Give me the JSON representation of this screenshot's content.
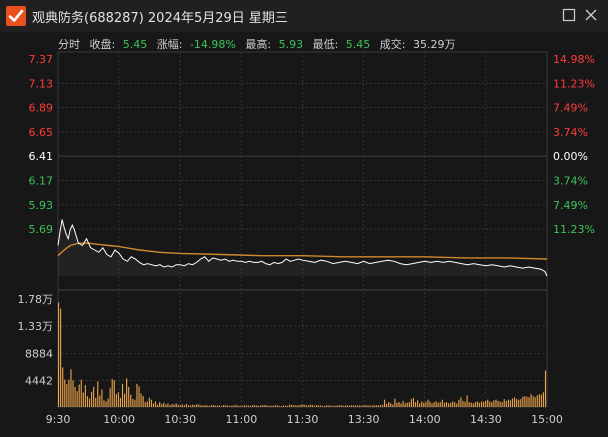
{
  "window": {
    "title": "观典防务(688287) 2024年5月29日 星期三"
  },
  "info_bar": {
    "mode_label": "分时",
    "close_label": "收盘:",
    "close_value": "5.45",
    "change_label": "涨幅:",
    "change_value": "-14.98%",
    "high_label": "最高:",
    "high_value": "5.93",
    "low_label": "最低:",
    "low_value": "5.45",
    "volume_label": "成交:",
    "volume_value": "35.29万"
  },
  "colors": {
    "up": "#ff3b3b",
    "down": "#3cc35a",
    "flat": "#ffffff",
    "price_line": "#ffffff",
    "avg_line": "#d08a2a",
    "volume_bar": "#e8a24a",
    "grid": "#3a3a3a",
    "background": "#171717"
  },
  "chart_data": {
    "type": "line",
    "price_axis_left": [
      "7.37",
      "7.13",
      "6.89",
      "6.65",
      "6.41",
      "6.17",
      "5.93",
      "5.69"
    ],
    "price_axis_right": [
      "14.98%",
      "11.23%",
      "7.49%",
      "3.74%",
      "0.00%",
      "3.74%",
      "7.49%",
      "11.23%"
    ],
    "price_axis_colors": [
      "up",
      "up",
      "up",
      "up",
      "flat",
      "down",
      "down",
      "down"
    ],
    "price_ylim": [
      5.45,
      7.37
    ],
    "volume_axis": [
      "1.78万",
      "1.33万",
      "8884",
      "4442"
    ],
    "volume_ylim": [
      0,
      17768
    ],
    "time_axis": [
      "9:30",
      "10:00",
      "10:30",
      "11:00",
      "11:30",
      "13:30",
      "14:00",
      "14:30",
      "15:00"
    ],
    "series": [
      {
        "name": "price",
        "points": [
          [
            0,
            5.72
          ],
          [
            1,
            5.84
          ],
          [
            2,
            5.95
          ],
          [
            3,
            5.88
          ],
          [
            4,
            5.82
          ],
          [
            5,
            5.78
          ],
          [
            6,
            5.86
          ],
          [
            7,
            5.9
          ],
          [
            8,
            5.86
          ],
          [
            9,
            5.8
          ],
          [
            10,
            5.74
          ],
          [
            12,
            5.72
          ],
          [
            14,
            5.78
          ],
          [
            16,
            5.7
          ],
          [
            18,
            5.68
          ],
          [
            20,
            5.66
          ],
          [
            22,
            5.7
          ],
          [
            24,
            5.64
          ],
          [
            26,
            5.62
          ],
          [
            28,
            5.68
          ],
          [
            30,
            5.65
          ],
          [
            32,
            5.6
          ],
          [
            34,
            5.58
          ],
          [
            36,
            5.62
          ],
          [
            38,
            5.6
          ],
          [
            40,
            5.57
          ],
          [
            42,
            5.55
          ],
          [
            44,
            5.56
          ],
          [
            46,
            5.55
          ],
          [
            48,
            5.54
          ],
          [
            50,
            5.55
          ],
          [
            52,
            5.53
          ],
          [
            54,
            5.54
          ],
          [
            56,
            5.53
          ],
          [
            58,
            5.55
          ],
          [
            60,
            5.55
          ],
          [
            62,
            5.54
          ],
          [
            64,
            5.56
          ],
          [
            66,
            5.55
          ],
          [
            68,
            5.57
          ],
          [
            70,
            5.6
          ],
          [
            72,
            5.62
          ],
          [
            74,
            5.58
          ],
          [
            76,
            5.61
          ],
          [
            78,
            5.6
          ],
          [
            80,
            5.59
          ],
          [
            82,
            5.6
          ],
          [
            84,
            5.58
          ],
          [
            86,
            5.59
          ],
          [
            88,
            5.58
          ],
          [
            90,
            5.58
          ],
          [
            92,
            5.57
          ],
          [
            94,
            5.58
          ],
          [
            96,
            5.57
          ],
          [
            98,
            5.57
          ],
          [
            100,
            5.58
          ],
          [
            102,
            5.56
          ],
          [
            104,
            5.55
          ],
          [
            106,
            5.57
          ],
          [
            108,
            5.56
          ],
          [
            110,
            5.57
          ],
          [
            112,
            5.6
          ],
          [
            114,
            5.58
          ],
          [
            116,
            5.59
          ],
          [
            118,
            5.6
          ],
          [
            120,
            5.59
          ],
          [
            123,
            5.58
          ],
          [
            126,
            5.57
          ],
          [
            129,
            5.59
          ],
          [
            132,
            5.58
          ],
          [
            135,
            5.56
          ],
          [
            138,
            5.57
          ],
          [
            141,
            5.58
          ],
          [
            144,
            5.57
          ],
          [
            147,
            5.56
          ],
          [
            150,
            5.58
          ],
          [
            153,
            5.56
          ],
          [
            156,
            5.57
          ],
          [
            159,
            5.58
          ],
          [
            162,
            5.59
          ],
          [
            165,
            5.58
          ],
          [
            168,
            5.56
          ],
          [
            171,
            5.55
          ],
          [
            174,
            5.56
          ],
          [
            177,
            5.57
          ],
          [
            180,
            5.58
          ],
          [
            183,
            5.57
          ],
          [
            186,
            5.58
          ],
          [
            189,
            5.57
          ],
          [
            192,
            5.58
          ],
          [
            195,
            5.57
          ],
          [
            198,
            5.56
          ],
          [
            201,
            5.55
          ],
          [
            204,
            5.56
          ],
          [
            207,
            5.55
          ],
          [
            210,
            5.54
          ],
          [
            213,
            5.55
          ],
          [
            216,
            5.54
          ],
          [
            219,
            5.53
          ],
          [
            222,
            5.54
          ],
          [
            225,
            5.53
          ],
          [
            228,
            5.52
          ],
          [
            231,
            5.53
          ],
          [
            234,
            5.52
          ],
          [
            237,
            5.51
          ],
          [
            239,
            5.49
          ],
          [
            240,
            5.45
          ]
        ]
      },
      {
        "name": "average",
        "points": [
          [
            0,
            5.63
          ],
          [
            3,
            5.68
          ],
          [
            6,
            5.72
          ],
          [
            10,
            5.74
          ],
          [
            15,
            5.74
          ],
          [
            20,
            5.73
          ],
          [
            25,
            5.72
          ],
          [
            30,
            5.71
          ],
          [
            40,
            5.68
          ],
          [
            50,
            5.66
          ],
          [
            60,
            5.65
          ],
          [
            80,
            5.64
          ],
          [
            100,
            5.63
          ],
          [
            120,
            5.63
          ],
          [
            140,
            5.62
          ],
          [
            160,
            5.62
          ],
          [
            180,
            5.62
          ],
          [
            200,
            5.61
          ],
          [
            220,
            5.61
          ],
          [
            240,
            5.6
          ]
        ]
      }
    ],
    "volume": [
      17200,
      16200,
      6500,
      4500,
      3800,
      4500,
      6200,
      4400,
      3300,
      2600,
      3700,
      4500,
      2400,
      3600,
      1800,
      1400,
      2500,
      3300,
      1500,
      4200,
      1900,
      2900,
      1100,
      900,
      1400,
      3100,
      4600,
      4400,
      2100,
      2400,
      1500,
      3800,
      2200,
      4700,
      3300,
      2000,
      1300,
      1200,
      3800,
      3400,
      2200,
      1800,
      800,
      900,
      1500,
      1200,
      600,
      900,
      400,
      800,
      500,
      700,
      400,
      600,
      300,
      500,
      400,
      600,
      350,
      300,
      420,
      300,
      500,
      280,
      260,
      380,
      310,
      450,
      400,
      300,
      250,
      320,
      260,
      200,
      300,
      320,
      240,
      250,
      260,
      180,
      320,
      300,
      240,
      200,
      210,
      260,
      350,
      220,
      200,
      180,
      280,
      240,
      230,
      200,
      300,
      320,
      250,
      200,
      260,
      300,
      330,
      280,
      200,
      210,
      220,
      300,
      260,
      180,
      160,
      240,
      220,
      200,
      400,
      350,
      300,
      260,
      280,
      320,
      450,
      380,
      300,
      250,
      400,
      350,
      200,
      300,
      280,
      250,
      200,
      180,
      300,
      260,
      230,
      200,
      220,
      260,
      280,
      300,
      200,
      250,
      260,
      230,
      300,
      280,
      250,
      240,
      260,
      230,
      280,
      300,
      260,
      240,
      220,
      300,
      260,
      280,
      320,
      400,
      1200,
      500,
      800,
      600,
      400,
      1400,
      700,
      800,
      600,
      1000,
      600,
      700,
      800,
      1300,
      1500,
      800,
      1100,
      600,
      900,
      700,
      800,
      1200,
      900,
      600,
      800,
      900,
      700,
      800,
      1200,
      700,
      800,
      600,
      700,
      900,
      800,
      600,
      1200,
      1600,
      1000,
      900,
      1900,
      800,
      700,
      600,
      800,
      900,
      700,
      900,
      800,
      1000,
      1200,
      900,
      800,
      1100,
      1200,
      1000,
      900,
      800,
      1300,
      1000,
      1200,
      1100,
      1400,
      1600,
      1300,
      1200,
      1300,
      1700,
      1800,
      1700,
      1600,
      2100,
      1800,
      1600,
      1900,
      2100,
      2000,
      2400,
      6000
    ]
  }
}
